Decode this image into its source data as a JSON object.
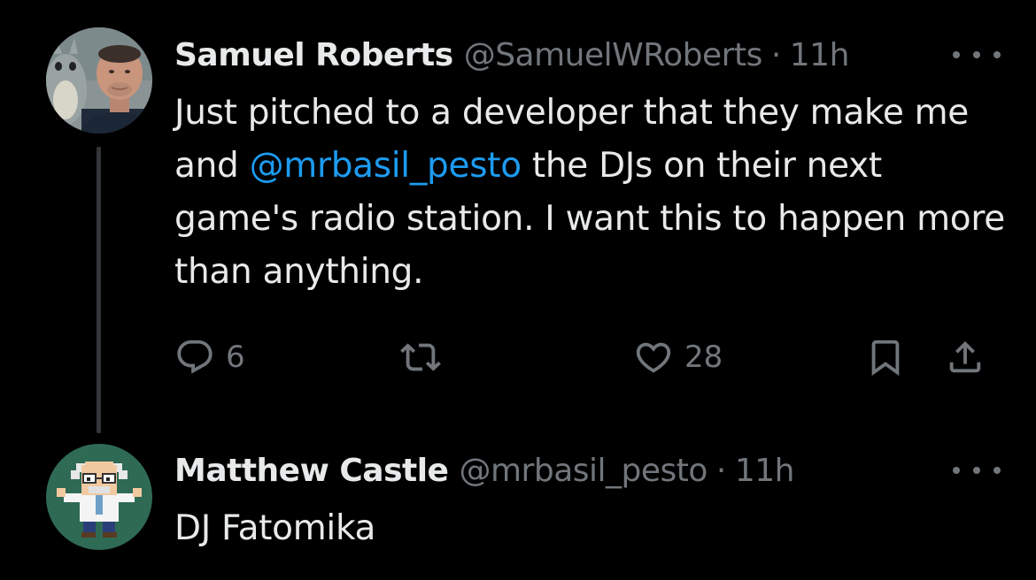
{
  "tweets": [
    {
      "author": {
        "name": "Samuel Roberts",
        "handle": "@SamuelWRoberts",
        "avatar": "avatar-photo"
      },
      "time": "11h",
      "separator": "·",
      "text_before": "Just pitched to a developer that they make me and ",
      "mention": "@mrbasil_pesto",
      "text_after": " the DJs on their next game's radio station. I want this to happen more than anything.",
      "actions": {
        "reply_count": "6",
        "retweet_count": "",
        "like_count": "28"
      }
    },
    {
      "author": {
        "name": "Matthew Castle",
        "handle": "@mrbasil_pesto",
        "avatar": "avatar-pixel-scientist"
      },
      "time": "11h",
      "separator": "·",
      "text": "DJ Fatomika"
    }
  ],
  "icons": {
    "reply": "reply-icon",
    "retweet": "retweet-icon",
    "like": "heart-icon",
    "bookmark": "bookmark-icon",
    "share": "share-icon",
    "more": "more-options-icon"
  },
  "colors": {
    "background": "#000000",
    "primary_text": "#e7e9ea",
    "secondary_text": "#71767b",
    "link": "#1d9bf0",
    "thread_line": "#333639"
  }
}
